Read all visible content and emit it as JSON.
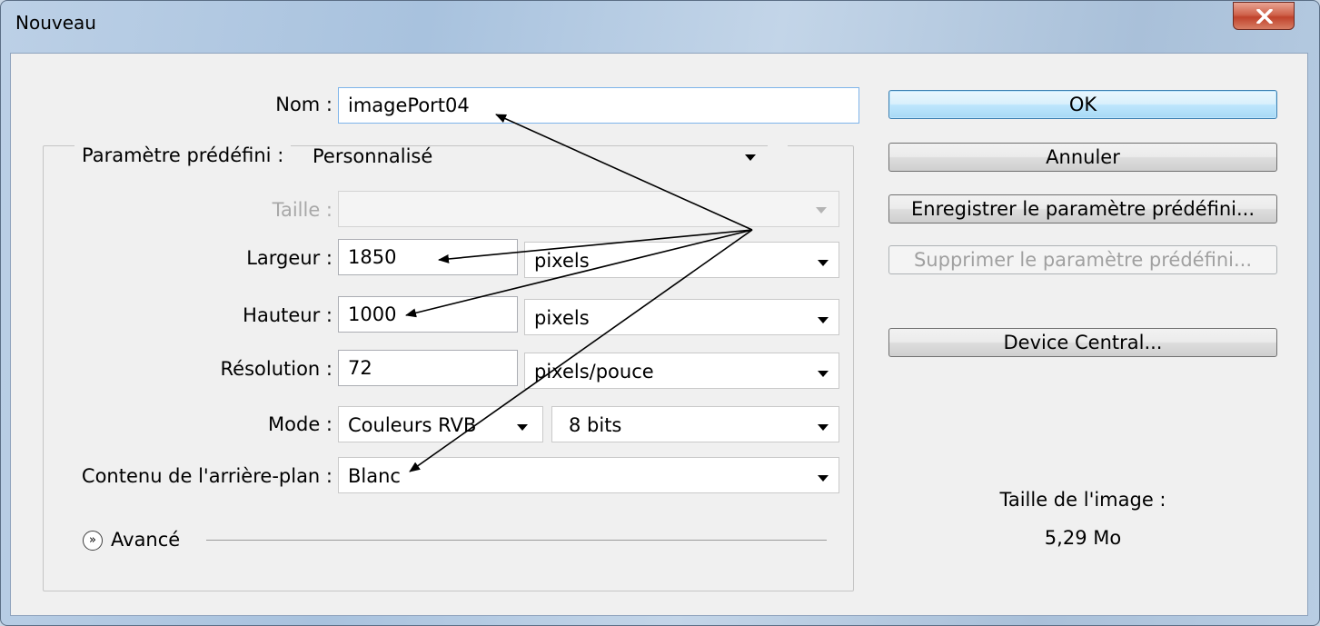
{
  "window": {
    "title": "Nouveau",
    "close_icon": "close-x-icon"
  },
  "form": {
    "nom_label": "Nom :",
    "nom_value": "imagePort04",
    "preset_label": "Paramètre prédéfini :",
    "preset_value": "Personnalisé",
    "taille_label": "Taille :",
    "taille_value": "",
    "largeur_label": "Largeur :",
    "largeur_value": "1850",
    "largeur_unit": "pixels",
    "hauteur_label": "Hauteur :",
    "hauteur_value": "1000",
    "hauteur_unit": "pixels",
    "resolution_label": "Résolution :",
    "resolution_value": "72",
    "resolution_unit": "pixels/pouce",
    "mode_label": "Mode :",
    "mode_value": "Couleurs RVB",
    "mode_bits": "8 bits",
    "contenu_label": "Contenu de l'arrière-plan :",
    "contenu_value": "Blanc",
    "avance_label": "Avancé"
  },
  "buttons": {
    "ok": "OK",
    "annuler": "Annuler",
    "enregistrer": "Enregistrer le paramètre prédéfini...",
    "supprimer": "Supprimer le paramètre prédéfini...",
    "device_central": "Device Central..."
  },
  "info": {
    "taille_image_label": "Taille de l'image :",
    "taille_image_value": "5,29 Mo"
  },
  "colors": {
    "annotation_arrows": "#000000",
    "default_button": "#bee6fd",
    "close_button": "#c0432c"
  }
}
